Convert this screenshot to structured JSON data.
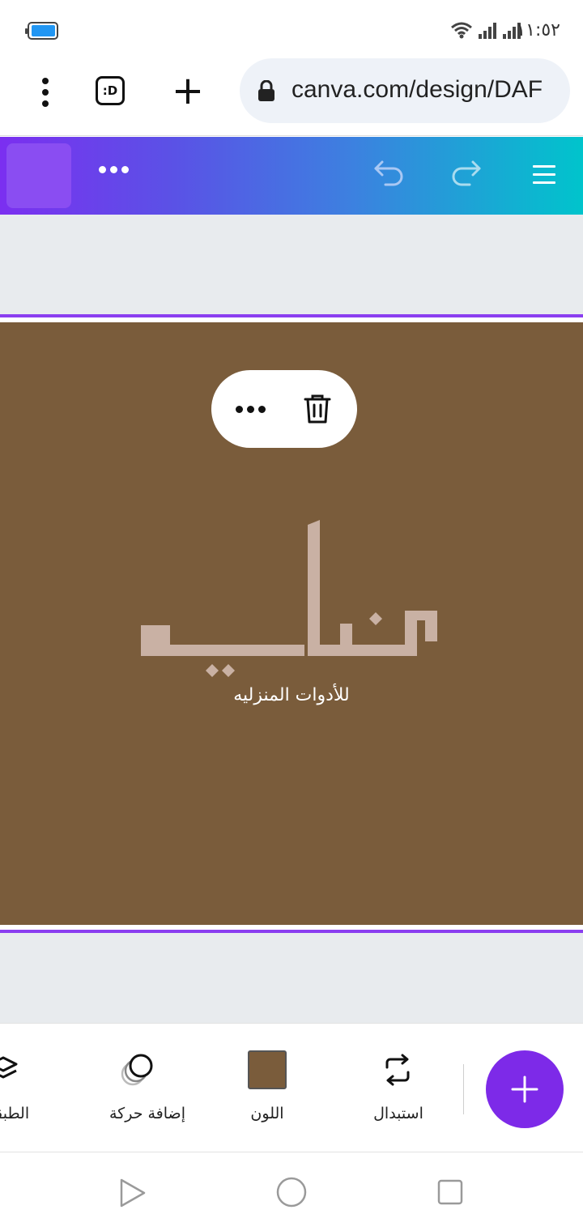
{
  "status_bar": {
    "time": "١١:٥٢",
    "battery_level": 0.85,
    "battery_color": "#2196f3"
  },
  "browser": {
    "url": "canva.com/design/DAF",
    "tab_icon_label": ":D",
    "new_tab_symbol": "+"
  },
  "canva_header": {
    "icons": [
      "more-icon",
      "undo-icon",
      "redo-icon",
      "menu-icon"
    ]
  },
  "canvas": {
    "background_color": "#7a5c3b",
    "logo_tagline": "للأدوات المنزليه",
    "logo_color": "#c9b1a4"
  },
  "context_menu": {
    "icons": [
      "more-icon",
      "trash-icon"
    ]
  },
  "toolbar": {
    "replace_label": "استبدال",
    "color_label": "اللون",
    "animate_label": "إضافة حركة",
    "layers_label": "الطبقة",
    "swatch_color": "#7a5c3b",
    "accent_color": "#7d2ae8"
  },
  "nav_bar": {
    "icons": [
      "back-icon",
      "home-icon",
      "recents-icon"
    ]
  }
}
